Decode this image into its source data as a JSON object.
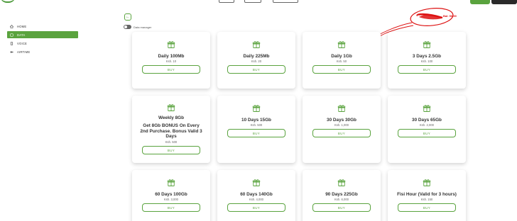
{
  "sidebar": {
    "items": [
      {
        "label": "HOME",
        "icon": "home-icon",
        "active": false
      },
      {
        "label": "DATA",
        "icon": "data-icon",
        "active": true
      },
      {
        "label": "VOICE",
        "icon": "voice-icon",
        "active": false
      },
      {
        "label": "AIRTIME",
        "icon": "airtime-icon",
        "active": false
      }
    ]
  },
  "toolbar": {
    "back_symbol": "←",
    "toggle_label": "Data manager",
    "balance": "Bal: 50.39"
  },
  "buy_label": "BUY",
  "bundles": [
    {
      "name": "Daily 100Mb",
      "price": "Ksh. 10"
    },
    {
      "name": "Daily 225Mb",
      "price": "Ksh. 20"
    },
    {
      "name": "Daily 1Gb",
      "price": "Ksh. 50"
    },
    {
      "name": "3 Days 2.5Gb",
      "price": "Ksh. 100"
    },
    {
      "name": "Weekly 8Gb",
      "desc": "Get 8Gb BONUS On Every 2nd Purchase. Bonus Valid 3 Days",
      "price": "Ksh. 500"
    },
    {
      "name": "10 Days 15Gb",
      "price": "Ksh. 500"
    },
    {
      "name": "30 Days 30Gb",
      "price": "Ksh. 1,000"
    },
    {
      "name": "30 Days 65Gb",
      "price": "Ksh. 2,000"
    },
    {
      "name": "60 Days 100Gb",
      "price": "Ksh. 3,000"
    },
    {
      "name": "60 Days 140Gb",
      "price": "Ksh. 4,000"
    },
    {
      "name": "90 Days 225Gb",
      "price": "Ksh. 6,000"
    },
    {
      "name": "Fisi Hour (Valid for 3 hours)",
      "price": "Ksh. 150"
    }
  ],
  "colors": {
    "accent": "#5aa33e",
    "annotation": "#dd1111"
  }
}
